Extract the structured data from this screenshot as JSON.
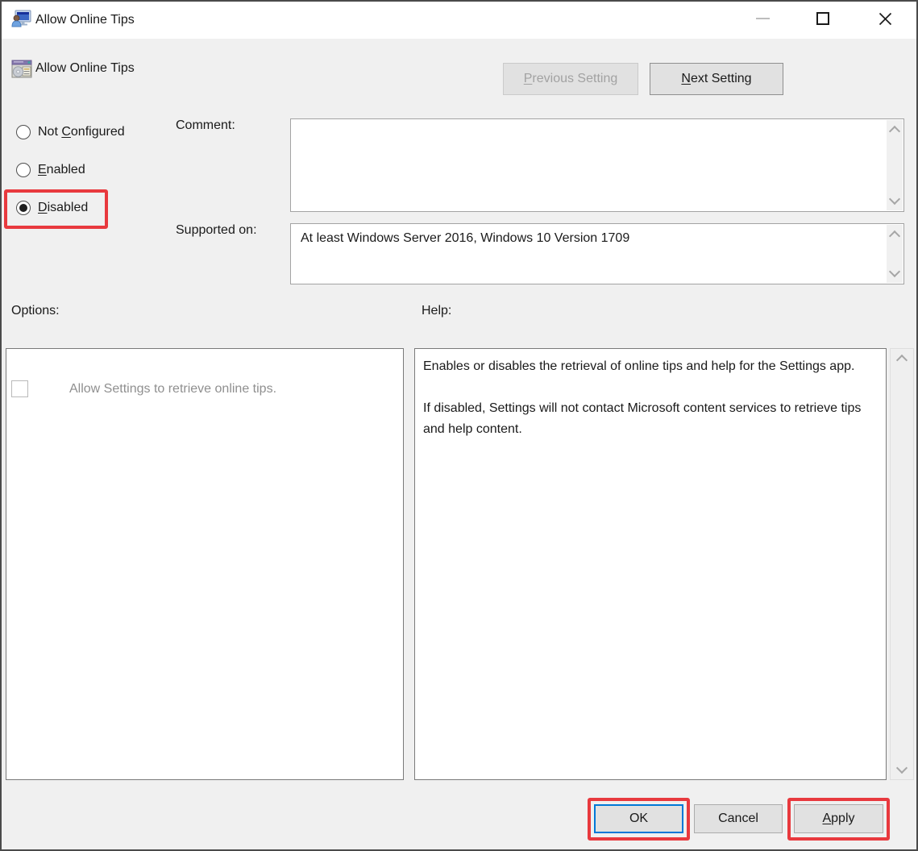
{
  "colors": {
    "annotation_red": "#E8393E",
    "accent_blue": "#0078D7",
    "window_bg": "#F0F0F0",
    "titlebar_bg": "#FFFFFF",
    "button_bg": "#E1E1E1"
  },
  "titlebar": {
    "title": "Allow Online Tips",
    "app_icon": "group-policy-app-icon",
    "minimize_icon": "minimize-icon",
    "maximize_icon": "maximize-icon",
    "close_icon": "close-icon"
  },
  "header": {
    "setting_icon": "policy-setting-icon",
    "title": "Allow Online Tips",
    "previous_button": {
      "key": "P",
      "rest": "revious Setting",
      "enabled": false
    },
    "next_button": {
      "key": "N",
      "rest": "ext Setting",
      "enabled": true
    }
  },
  "state_radios": [
    {
      "pre": "Not ",
      "key": "C",
      "rest": "onfigured",
      "selected": false
    },
    {
      "pre": "",
      "key": "E",
      "rest": "nabled",
      "selected": false
    },
    {
      "pre": "",
      "key": "D",
      "rest": "isabled",
      "selected": true
    }
  ],
  "comment": {
    "label": "Comment:",
    "value": ""
  },
  "supported_on": {
    "label": "Supported on:",
    "value": "At least Windows Server 2016, Windows 10 Version 1709"
  },
  "options": {
    "label": "Options:",
    "checkbox": {
      "label": "Allow Settings to retrieve online tips.",
      "checked": false,
      "enabled": false
    }
  },
  "help": {
    "label": "Help:",
    "paragraph1": "Enables or disables the retrieval of online tips and help for the Settings app.",
    "paragraph2": "If disabled, Settings will not contact Microsoft content services to retrieve tips and help content."
  },
  "footer": {
    "ok_button": "OK",
    "cancel_button": "Cancel",
    "apply_button": {
      "key": "A",
      "rest": "pply"
    }
  }
}
